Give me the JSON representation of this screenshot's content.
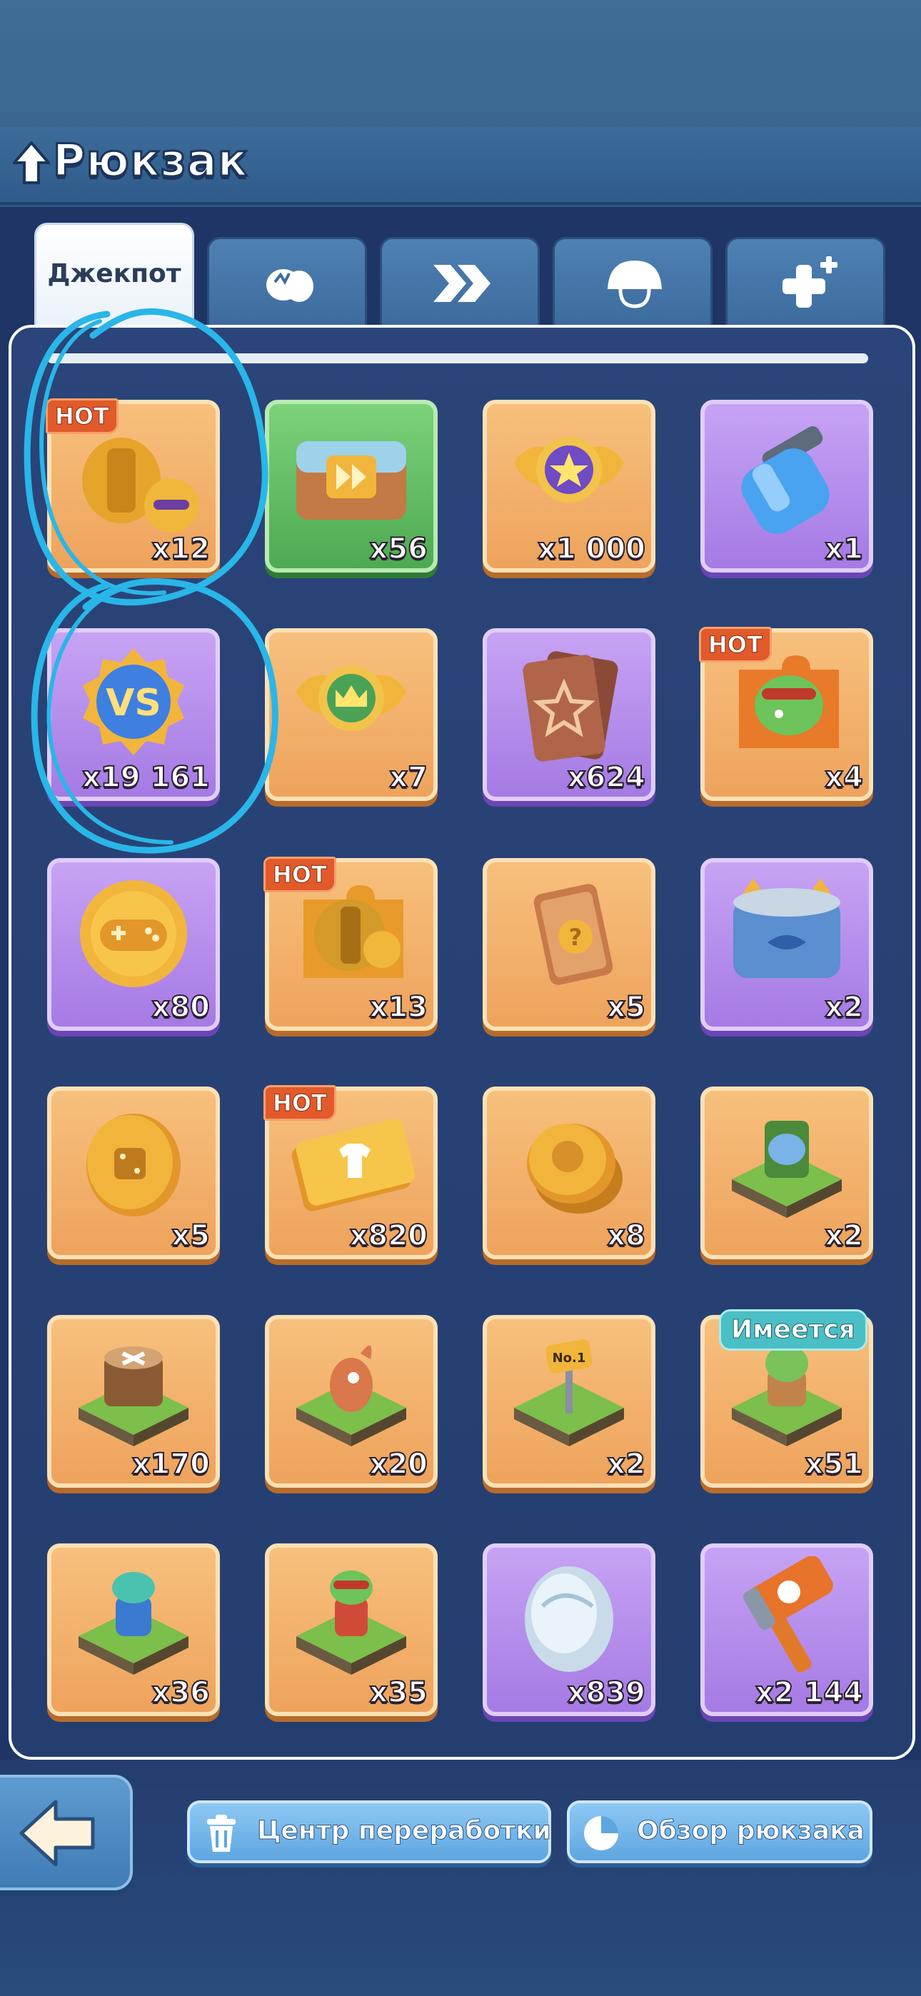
{
  "header": {
    "title": "Рюкзак"
  },
  "tabs": [
    {
      "label": "Джекпот",
      "active": true,
      "icon": "jackpot-tab"
    },
    {
      "label": "",
      "active": false,
      "icon": "egg-icon"
    },
    {
      "label": "",
      "active": false,
      "icon": "double-chevron-icon"
    },
    {
      "label": "",
      "active": false,
      "icon": "helmet-icon"
    },
    {
      "label": "",
      "active": false,
      "icon": "plus-icon"
    }
  ],
  "items": [
    {
      "count": "x12",
      "bg": "orange",
      "badge": "HOT",
      "icon": "gold-armor-icon"
    },
    {
      "count": "x56",
      "bg": "green",
      "badge": "",
      "icon": "chest-icon"
    },
    {
      "count": "x1 000",
      "bg": "orange",
      "badge": "",
      "icon": "star-wings-badge-icon"
    },
    {
      "count": "x1",
      "bg": "purple",
      "badge": "",
      "icon": "blue-jar-icon"
    },
    {
      "count": "x19 161",
      "bg": "purple",
      "badge": "",
      "icon": "vs-medal-icon"
    },
    {
      "count": "x7",
      "bg": "orange",
      "badge": "",
      "icon": "crown-wings-badge-icon"
    },
    {
      "count": "x624",
      "bg": "purple",
      "badge": "",
      "icon": "star-card-icon"
    },
    {
      "count": "x4",
      "bg": "orange",
      "badge": "HOT",
      "icon": "frog-puzzle-icon"
    },
    {
      "count": "x80",
      "bg": "purple",
      "badge": "",
      "icon": "gamepad-coin-icon"
    },
    {
      "count": "x13",
      "bg": "orange",
      "badge": "HOT",
      "icon": "armor-puzzle-icon"
    },
    {
      "count": "x5",
      "bg": "orange",
      "badge": "",
      "icon": "question-card-icon"
    },
    {
      "count": "x2",
      "bg": "purple",
      "badge": "",
      "icon": "cat-food-can-icon"
    },
    {
      "count": "x5",
      "bg": "orange",
      "badge": "",
      "icon": "dice-coin-icon"
    },
    {
      "count": "x820",
      "bg": "orange",
      "badge": "HOT",
      "icon": "shirt-ticket-icon"
    },
    {
      "count": "x8",
      "bg": "orange",
      "badge": "",
      "icon": "coin-stack-icon"
    },
    {
      "count": "x2",
      "bg": "orange",
      "badge": "",
      "icon": "garden-tile-icon"
    },
    {
      "count": "x170",
      "bg": "orange",
      "badge": "",
      "icon": "stump-tile-icon"
    },
    {
      "count": "x20",
      "bg": "orange",
      "badge": "",
      "icon": "creature-tile-icon"
    },
    {
      "count": "x2",
      "bg": "orange",
      "badge": "",
      "icon": "trophy-sign-tile-icon"
    },
    {
      "count": "x51",
      "bg": "orange",
      "badge": "Имеется",
      "icon": "frog-statue-tile-icon"
    },
    {
      "count": "x36",
      "bg": "orange",
      "badge": "",
      "icon": "robot-frog-tile-icon"
    },
    {
      "count": "x35",
      "bg": "orange",
      "badge": "",
      "icon": "cool-frog-tile-icon"
    },
    {
      "count": "x839",
      "bg": "purple",
      "badge": "",
      "icon": "crystal-egg-icon"
    },
    {
      "count": "x2 144",
      "bg": "purple",
      "badge": "",
      "icon": "hammer-icon"
    }
  ],
  "footer": {
    "recycle_label": "Центр переработки",
    "overview_label": "Обзор рюкзака"
  },
  "colors": {
    "background": "#1f3566",
    "item_orange": "#f0a85f",
    "item_purple": "#b48be9",
    "item_green": "#5cb55d",
    "hot_badge": "#e25a2a",
    "owned_badge": "#4bbfc6",
    "annotation": "#29b6e8"
  }
}
